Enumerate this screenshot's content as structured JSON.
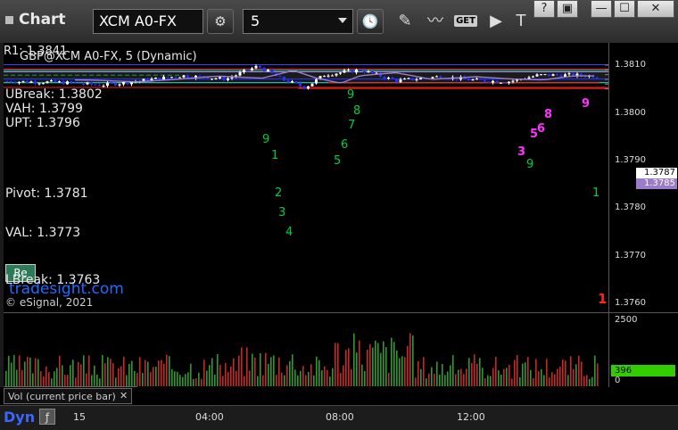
{
  "titlebar": {
    "app_title": "Chart",
    "symbol": "XCM A0-FX",
    "interval": "5"
  },
  "window": {
    "help": "?",
    "restore": "▣",
    "minimize": "—",
    "maximize": "☐",
    "close": "✕"
  },
  "tools": {
    "get_label": "GET"
  },
  "chart": {
    "legend_r1": "R1: 1.3841",
    "legend_symbol": "GBP@XCM A0-FX, 5 (Dynamic)",
    "ubreak": "UBreak: 1.3802",
    "vah": "VAH: 1.3799",
    "upt": "UPT: 1.3796",
    "pivot": "Pivot: 1.3781",
    "val": "VAL: 1.3773",
    "lbreak": "LBreak: 1.3763",
    "watermark": "tradesight.com",
    "copyright": "© eSignal, 2021",
    "button_label": "Re",
    "price_ticks": [
      "1.3810",
      "1.3800",
      "1.3790",
      "1.3780",
      "1.3770",
      "1.3760"
    ],
    "price_last": "1.3787",
    "price_avg": "1.3785",
    "counts_green": [
      "9",
      "9",
      "1",
      "2",
      "3",
      "4",
      "5",
      "6",
      "7",
      "8",
      "9",
      "1"
    ],
    "counts_magenta": [
      "3",
      "5",
      "6",
      "8",
      "9"
    ],
    "count_red": "1",
    "colors": {
      "bull": "#ffffff",
      "bear": "#2233ff",
      "ubreak": "#ff2020",
      "vah": "#40e0d0",
      "upt": "#b090e0",
      "pivot": "#2233ff",
      "avg": "#9a7cc8",
      "count_green": "#00cc44",
      "count_magenta": "#ff33ff"
    }
  },
  "volume": {
    "label": "Vol (current price bar)",
    "scale_top": "2500",
    "scale_bottom": "0",
    "current": "396",
    "current_color": "#33cc00"
  },
  "timeaxis": {
    "ticks": [
      "15",
      "04:00",
      "08:00",
      "12:00"
    ],
    "footer_label": "Dyn"
  }
}
